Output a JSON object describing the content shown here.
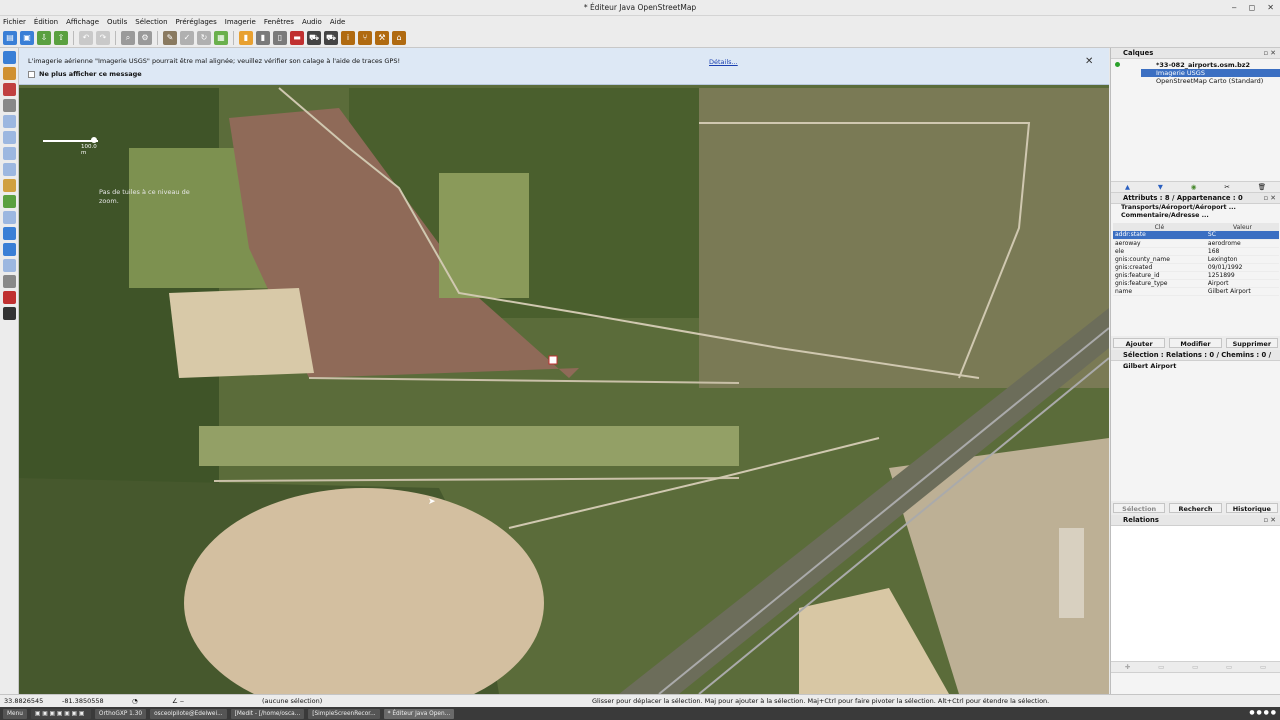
{
  "window": {
    "title": "* Éditeur Java OpenStreetMap",
    "controls": [
      "‒",
      "◻",
      "✕"
    ]
  },
  "menu": [
    "Fichier",
    "Édition",
    "Affichage",
    "Outils",
    "Sélection",
    "Préréglages",
    "Imagerie",
    "Fenêtres",
    "Audio",
    "Aide"
  ],
  "notice": {
    "message": "L'imagerie aérienne \"Imagerie USGS\" pourrait être mal alignée; veuillez vérifier son calage à l'aide de traces GPS!",
    "checkbox": "Ne plus afficher ce message",
    "details": "Détails...",
    "close": "✕"
  },
  "map": {
    "scale_label": "100.0 m",
    "no_imagery": "Pas de tuiles à ce niveau de zoom."
  },
  "layers_panel": {
    "title": "Calques",
    "layers": [
      {
        "name": "*33-082_airports.osm.bz2",
        "bold": true
      },
      {
        "name": "Imagerie USGS",
        "selected": true
      },
      {
        "name": "OpenStreetMap Carto (Standard)"
      }
    ]
  },
  "attributes_panel": {
    "title": "Attributs : 8 / Appartenance : 0",
    "preset_line1": "Transports/Aéroport/Aéroport ...",
    "preset_line2": "Commentaire/Adresse ...",
    "col_key": "Clé",
    "col_value": "Valeur",
    "tags": [
      {
        "k": "addr:state",
        "v": "SC",
        "selected": true
      },
      {
        "k": "aeroway",
        "v": "aerodrome"
      },
      {
        "k": "ele",
        "v": "168"
      },
      {
        "k": "gnis:county_name",
        "v": "Lexington"
      },
      {
        "k": "gnis:created",
        "v": "09/01/1992"
      },
      {
        "k": "gnis:feature_id",
        "v": "1251899"
      },
      {
        "k": "gnis:feature_type",
        "v": "Airport"
      },
      {
        "k": "name",
        "v": "Gilbert Airport"
      }
    ],
    "add": "Ajouter",
    "edit": "Modifier",
    "delete": "Supprimer"
  },
  "selection_panel": {
    "title": "Sélection : Relations : 0 / Chemins : 0 / ...",
    "item": "Gilbert Airport",
    "select": "Sélection",
    "search": "Recherch",
    "history": "Historique"
  },
  "relations_panel": {
    "title": "Relations"
  },
  "status": {
    "lat": "33.8826545",
    "lon": "-81.3850558",
    "selection": "(aucune sélection)",
    "hint": "Glisser pour déplacer la sélection. Maj pour ajouter à la sélection. Maj+Ctrl pour faire pivoter la sélection. Alt+Ctrl pour étendre la sélection."
  },
  "taskbar": {
    "menu": "Menu",
    "tasks": [
      "OrthoGXP 1.30",
      "osceolpilote@Edelwei...",
      "[Medit - [/home/osca...",
      "[SimpleScreenRecor...",
      "* Éditeur Java Open..."
    ],
    "active_task": 4
  },
  "colors": {
    "selection": "#3b6fc2",
    "notice_bg": "#dde8f5",
    "link": "#1a3fb0"
  }
}
